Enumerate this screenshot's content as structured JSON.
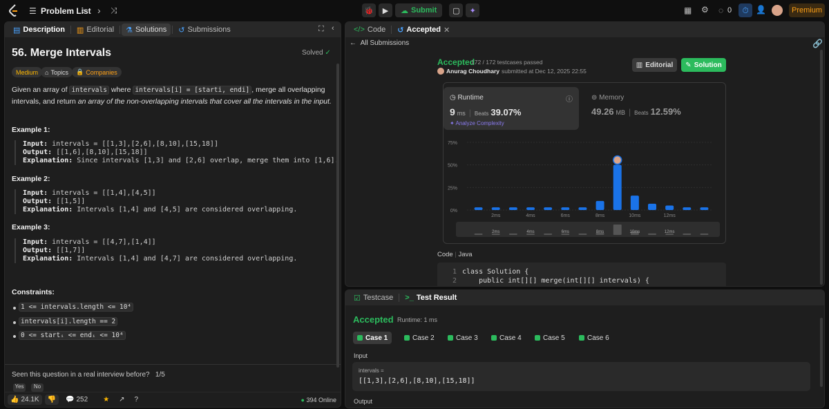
{
  "topbar": {
    "title": "Problem List",
    "submit_label": "Submit",
    "streak_count": "0",
    "premium_label": "Premium"
  },
  "left": {
    "tabs": [
      "Description",
      "Editorial",
      "Solutions",
      "Submissions"
    ],
    "problem_title": "56. Merge Intervals",
    "solved_label": "Solved",
    "tags": [
      "Medium",
      "Topics",
      "Companies"
    ],
    "desc_p1": "Given an array of",
    "desc_code1": "intervals",
    "desc_p2": "where",
    "desc_code2": "intervals[i] = [starti, endi]",
    "desc_p3": ", merge all overlapping intervals, and return",
    "desc_p4_italic": "an array of the non-overlapping intervals that cover all the intervals in the input.",
    "examples": [
      {
        "title": "Example 1:",
        "input": "intervals = [[1,3],[2,6],[8,10],[15,18]]",
        "output": "[[1,6],[8,10],[15,18]]",
        "explanation": "Since intervals [1,3] and [2,6] overlap, merge them into [1,6]."
      },
      {
        "title": "Example 2:",
        "input": "intervals = [[1,4],[4,5]]",
        "output": "[[1,5]]",
        "explanation": "Intervals [1,4] and [4,5] are considered overlapping."
      },
      {
        "title": "Example 3:",
        "input": "intervals = [[4,7],[1,4]]",
        "output": "[[1,7]]",
        "explanation": "Intervals [1,4] and [4,7] are considered overlapping."
      }
    ],
    "labels": {
      "input": "Input:",
      "output": "Output:",
      "explanation": "Explanation:"
    },
    "constraints_title": "Constraints:",
    "constraints": [
      "1 <= intervals.length <= 10⁴",
      "intervals[i].length == 2",
      "0 <= startᵢ <= endᵢ <= 10⁴"
    ],
    "interview_q": "Seen this question in a real interview before?",
    "interview_page": "1/5",
    "interview_opts": [
      "Yes",
      "No"
    ],
    "likes": "24.1K",
    "comments": "252",
    "online": "394 Online"
  },
  "rtop": {
    "tabs": [
      "Code",
      "Accepted"
    ],
    "all_submissions": "All Submissions",
    "status": "Accepted",
    "testcases": "172 / 172 testcases passed",
    "user": "Anurag Choudhary",
    "submitted_at": "submitted at Dec 12, 2025 22:55",
    "editorial_btn": "Editorial",
    "solution_btn": "Solution",
    "runtime_label": "Runtime",
    "runtime_value": "9",
    "runtime_unit": "ms",
    "beats_label": "Beats",
    "runtime_beats": "39.07%",
    "analyze": "Analyze Complexity",
    "memory_label": "Memory",
    "memory_value": "49.26",
    "memory_unit": "MB",
    "memory_beats": "12.59%",
    "code_label": "Code",
    "lang": "Java",
    "code_lines": [
      "class Solution {",
      "    public int[][] merge(int[][] intervals) {"
    ]
  },
  "chart_data": {
    "type": "bar",
    "ylabel_ticks": [
      "75%",
      "50%",
      "25%",
      "0%"
    ],
    "ylim": [
      0,
      75
    ],
    "x_ticks": [
      "2ms",
      "4ms",
      "6ms",
      "8ms",
      "10ms",
      "12ms"
    ],
    "categories": [
      "1ms",
      "2ms",
      "3ms",
      "4ms",
      "5ms",
      "6ms",
      "7ms",
      "8ms",
      "9ms",
      "10ms",
      "11ms",
      "12ms",
      "13ms",
      "14ms"
    ],
    "values": [
      3,
      3,
      3,
      3,
      3,
      3,
      3,
      10,
      50,
      16,
      7,
      5,
      3,
      3
    ],
    "highlight_index": 9,
    "grid": true
  },
  "rbot": {
    "tabs": [
      "Testcase",
      "Test Result"
    ],
    "status": "Accepted",
    "runtime": "Runtime: 1 ms",
    "cases": [
      "Case 1",
      "Case 2",
      "Case 3",
      "Case 4",
      "Case 5",
      "Case 6"
    ],
    "input_label": "Input",
    "var_name": "intervals =",
    "var_value": "[[1,3],[2,6],[8,10],[15,18]]",
    "output_label": "Output"
  },
  "colors": {
    "accent_green": "#2cbb5d",
    "premium": "#ffa116",
    "bar_blue": "#1a73e8",
    "medium": "#ffb800"
  }
}
